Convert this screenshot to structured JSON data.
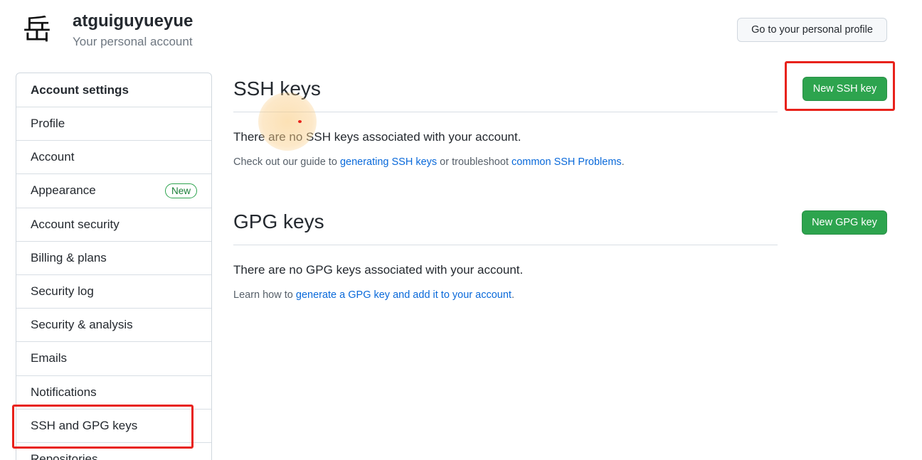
{
  "header": {
    "avatar_glyph": "岳",
    "username": "atguiguyueyue",
    "account_type": "Your personal account",
    "profile_button": "Go to your personal profile"
  },
  "sidebar": {
    "heading": "Account settings",
    "items": [
      {
        "label": "Profile"
      },
      {
        "label": "Account"
      },
      {
        "label": "Appearance",
        "badge": "New"
      },
      {
        "label": "Account security"
      },
      {
        "label": "Billing & plans"
      },
      {
        "label": "Security log"
      },
      {
        "label": "Security & analysis"
      },
      {
        "label": "Emails"
      },
      {
        "label": "Notifications"
      },
      {
        "label": "SSH and GPG keys"
      },
      {
        "label": "Repositories"
      }
    ]
  },
  "ssh": {
    "title": "SSH keys",
    "new_button": "New SSH key",
    "empty": "There are no SSH keys associated with your account.",
    "help_prefix": "Check out our guide to ",
    "help_link1": "generating SSH keys",
    "help_middle": " or troubleshoot ",
    "help_link2": "common SSH Problems",
    "help_suffix": "."
  },
  "gpg": {
    "title": "GPG keys",
    "new_button": "New GPG key",
    "empty": "There are no GPG keys associated with your account.",
    "help_prefix": "Learn how to ",
    "help_link": "generate a GPG key and add it to your account",
    "help_suffix": "."
  },
  "colors": {
    "accent_green": "#2da44e",
    "link_blue": "#0969da",
    "highlight_red": "#e8221b"
  }
}
